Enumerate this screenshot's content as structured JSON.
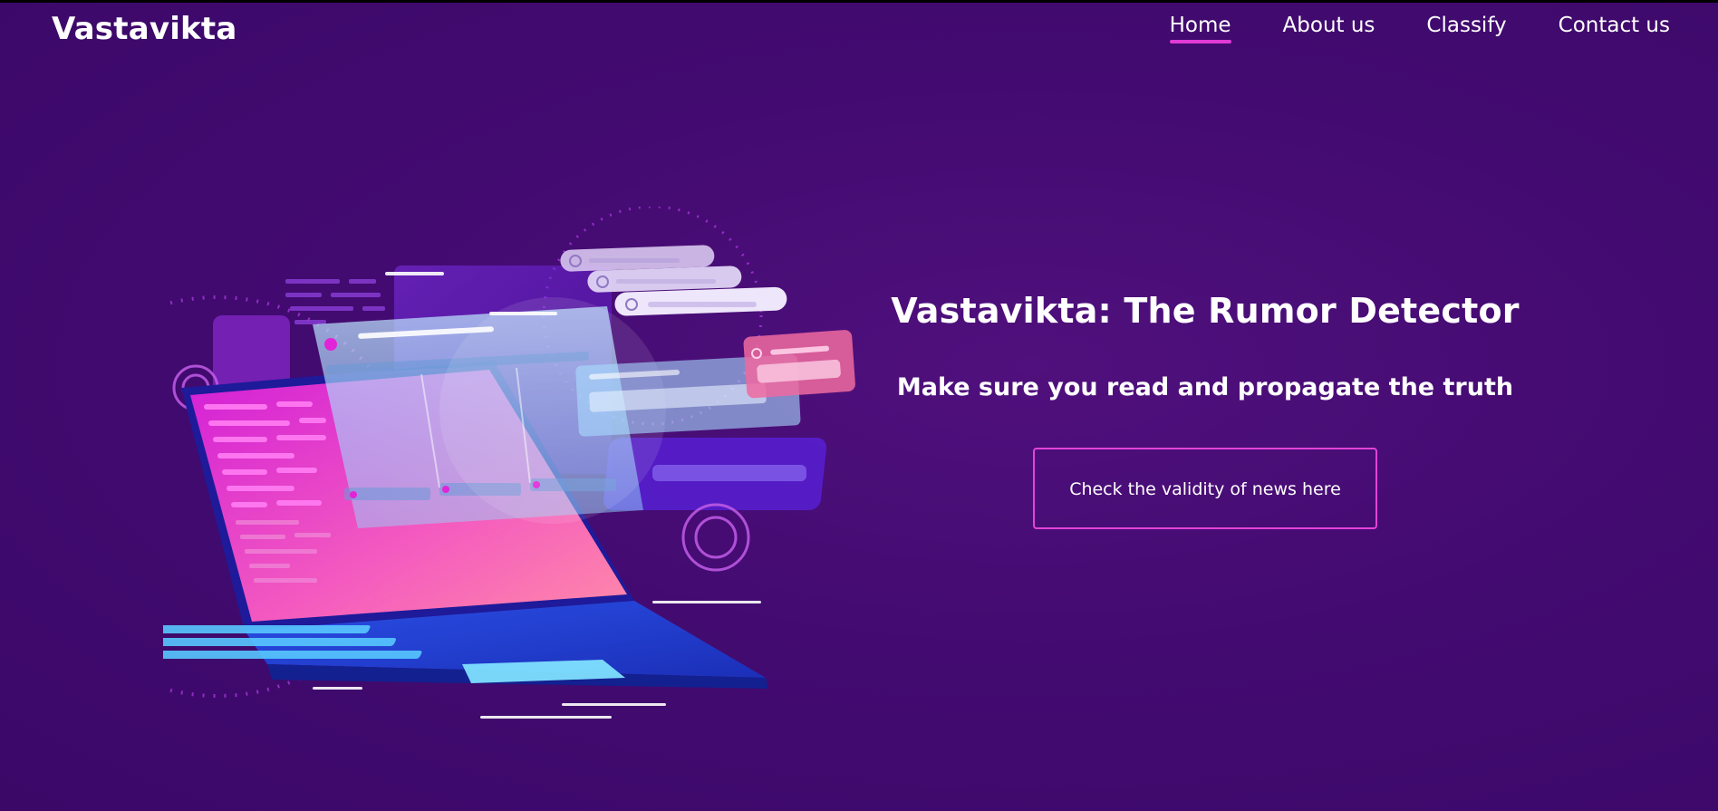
{
  "header": {
    "brand": "Vastavikta",
    "nav": [
      {
        "label": "Home",
        "active": true
      },
      {
        "label": "About us",
        "active": false
      },
      {
        "label": "Classify",
        "active": false
      },
      {
        "label": "Contact us",
        "active": false
      }
    ]
  },
  "hero": {
    "title": "Vastavikta: The Rumor Detector",
    "subtitle": "Make sure you read and propagate the truth",
    "cta_label": "Check the validity of news here"
  },
  "colors": {
    "background": "#430b71",
    "accent": "#e03ad6",
    "text": "#ffffff"
  },
  "illustration": {
    "icon": "laptop-dashboard-illustration"
  }
}
